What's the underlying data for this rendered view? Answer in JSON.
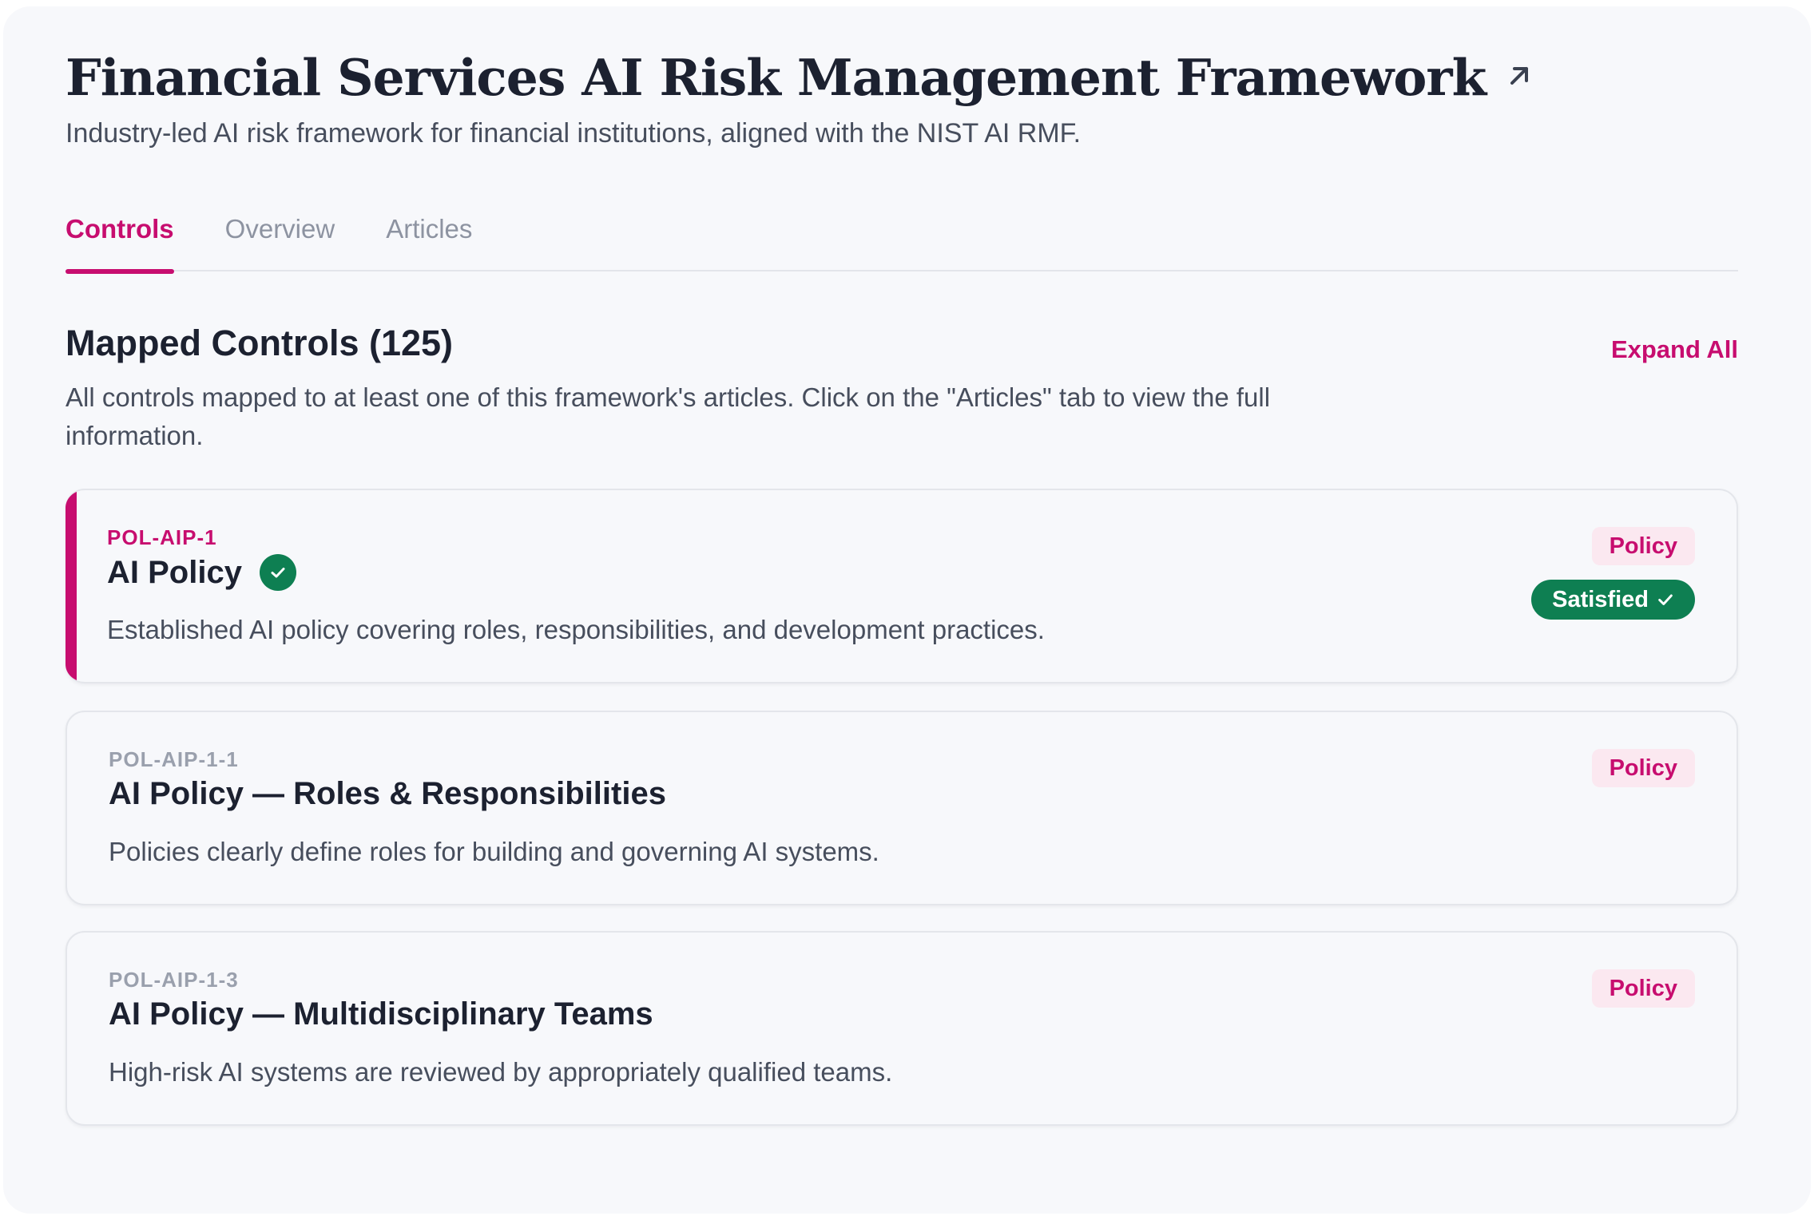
{
  "header": {
    "title": "Financial Services AI Risk Management Framework",
    "subtitle": "Industry-led AI risk framework for financial institutions, aligned with the NIST AI RMF."
  },
  "tabs": [
    {
      "label": "Controls",
      "active": true
    },
    {
      "label": "Overview",
      "active": false
    },
    {
      "label": "Articles",
      "active": false
    }
  ],
  "section": {
    "title": "Mapped Controls (125)",
    "expand_label": "Expand All",
    "description": "All controls mapped to at least one of this framework's articles. Click on the \"Articles\" tab to view the full information."
  },
  "controls": [
    {
      "id": "POL-AIP-1",
      "name": "AI Policy",
      "description": "Established AI policy covering roles, responsibilities, and development practices.",
      "tag": "Policy",
      "status": "Satisfied",
      "verified": true
    },
    {
      "id": "POL-AIP-1-1",
      "name": "AI Policy — Roles & Responsibilities",
      "description": "Policies clearly define roles for building and governing AI systems.",
      "tag": "Policy"
    },
    {
      "id": "POL-AIP-1-3",
      "name": "AI Policy — Multidisciplinary Teams",
      "description": "High-risk AI systems are reviewed by appropriately qualified teams.",
      "tag": "Policy"
    }
  ],
  "colors": {
    "accent": "#c70d6f",
    "success": "#0e7f52",
    "tag_bg": "#fbe8f0",
    "panel_bg": "#f7f8fb"
  },
  "icons": {
    "external": "external-link-icon",
    "verified": "check-circle-icon",
    "status": "check-icon"
  }
}
